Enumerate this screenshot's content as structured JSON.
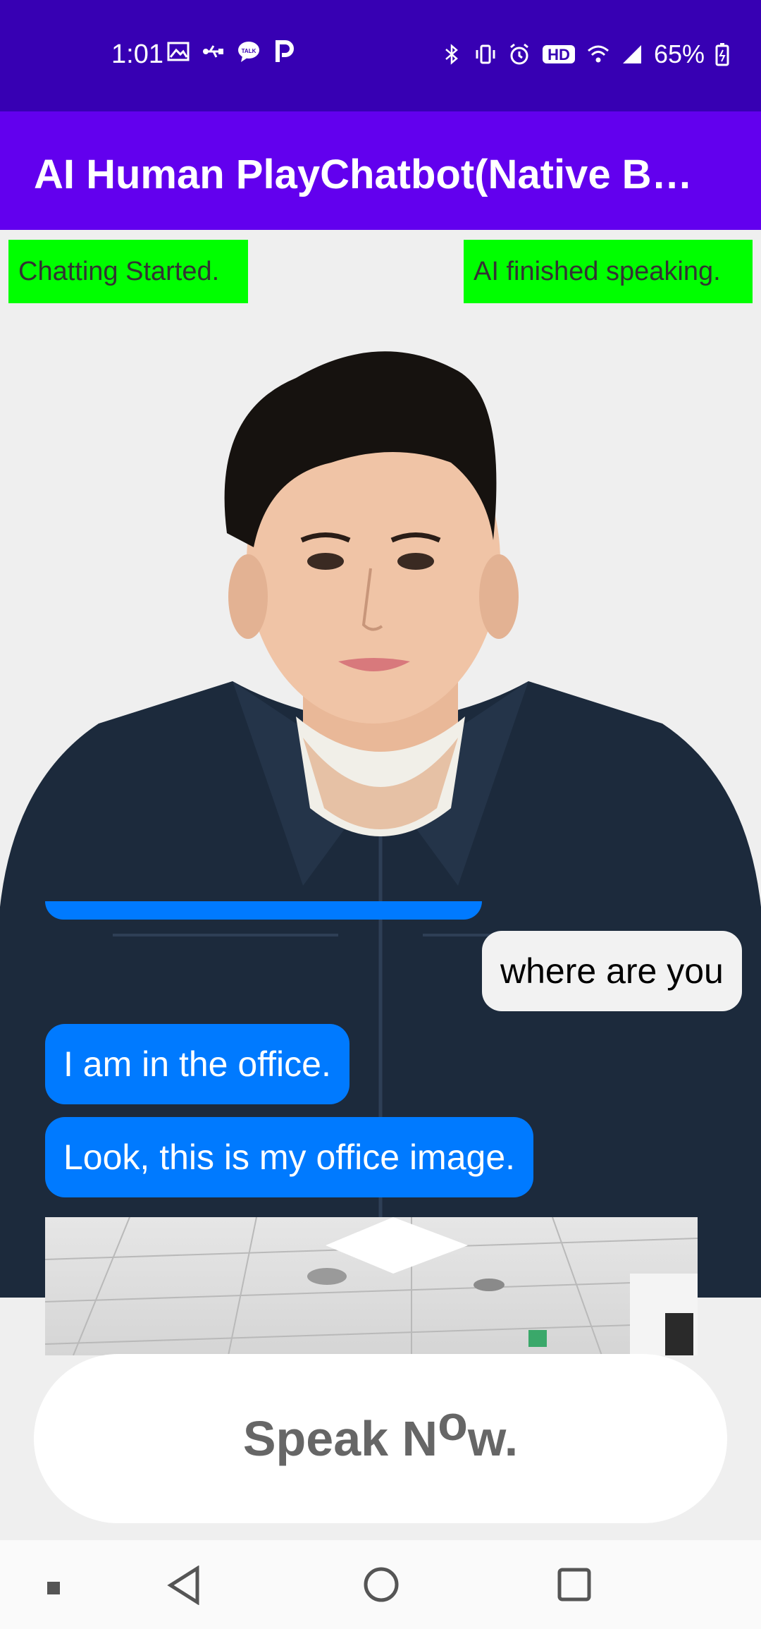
{
  "status_bar": {
    "time": "1:01",
    "battery": "65%",
    "left_icons": [
      "gallery-icon",
      "usb-icon",
      "talk-icon",
      "p-icon"
    ],
    "right_icons": [
      "bluetooth-icon",
      "vibrate-icon",
      "alarm-icon",
      "hd-icon",
      "wifi-icon",
      "signal-icon",
      "battery-icon"
    ]
  },
  "app_bar": {
    "title": "AI Human PlayChatbot(Native Bas…"
  },
  "status_tags": {
    "chat_status": "Chatting Started.",
    "ai_status": "AI finished speaking."
  },
  "chat": {
    "messages": [
      {
        "sender": "user",
        "text": "where are you"
      },
      {
        "sender": "ai",
        "text": "I am in the office."
      },
      {
        "sender": "ai",
        "text": "Look, this is my office image."
      }
    ]
  },
  "speak_button": {
    "label": "Speak N",
    "label_raised": "o",
    "label_end": "w."
  },
  "nav_bar": {
    "icons": [
      "recent-dot-icon",
      "back-icon",
      "home-icon",
      "overview-icon"
    ]
  },
  "colors": {
    "status_bar": "#3700b3",
    "app_bar": "#6200ee",
    "status_tag": "#00ff00",
    "ai_bubble": "#007aff",
    "user_bubble": "#f2f2f2",
    "background": "#efefef"
  }
}
